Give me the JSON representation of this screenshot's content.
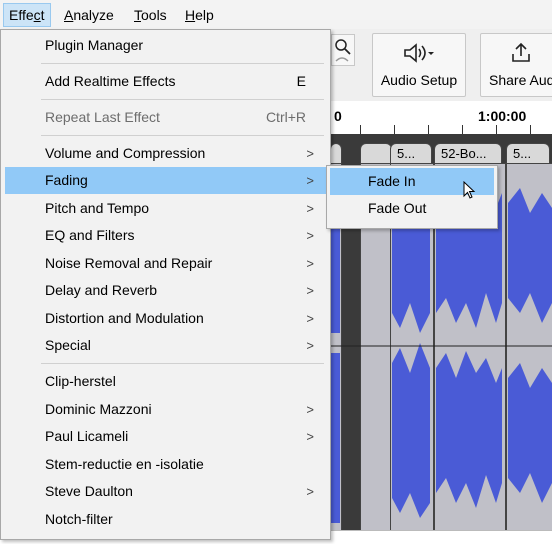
{
  "menubar": {
    "items": [
      {
        "label": "Effect",
        "u": "c"
      },
      {
        "label": "Analyze",
        "u": "A"
      },
      {
        "label": "Tools",
        "u": "T"
      },
      {
        "label": "Help",
        "u": "H"
      }
    ]
  },
  "toolbar": {
    "audio_setup_label": "Audio Setup",
    "share_audio_label": "Share Aud"
  },
  "ruler": {
    "left_label": "0",
    "right_label": "1:00:00"
  },
  "clips": [
    {
      "label": ""
    },
    {
      "label": ""
    },
    {
      "label": "5..."
    },
    {
      "label": "52-Bo..."
    },
    {
      "label": "5..."
    }
  ],
  "effect_menu": {
    "items": [
      {
        "label": "Plugin Manager"
      },
      {
        "label": "Add Realtime Effects",
        "shortcut": "E"
      },
      {
        "label": "Repeat Last Effect",
        "shortcut": "Ctrl+R",
        "disabled": true
      },
      {
        "label": "Volume and Compression",
        "submenu": true
      },
      {
        "label": "Fading",
        "submenu": true,
        "highlighted": true
      },
      {
        "label": "Pitch and Tempo",
        "submenu": true
      },
      {
        "label": "EQ and Filters",
        "submenu": true
      },
      {
        "label": "Noise Removal and Repair",
        "submenu": true
      },
      {
        "label": "Delay and Reverb",
        "submenu": true
      },
      {
        "label": "Distortion and Modulation",
        "submenu": true
      },
      {
        "label": "Special",
        "submenu": true
      },
      {
        "label": "Clip-herstel"
      },
      {
        "label": "Dominic Mazzoni",
        "submenu": true
      },
      {
        "label": "Paul Licameli",
        "submenu": true
      },
      {
        "label": "Stem-reductie en -isolatie"
      },
      {
        "label": "Steve Daulton",
        "submenu": true
      },
      {
        "label": "Notch-filter"
      }
    ],
    "arrow_glyph": ">"
  },
  "fading_submenu": {
    "items": [
      {
        "label": "Fade In",
        "highlighted": true
      },
      {
        "label": "Fade Out"
      }
    ]
  },
  "colors": {
    "menu_highlight": "#91c9f7",
    "waveform_blue": "#4a5bd6",
    "clip_background": "#c0c0c8"
  }
}
